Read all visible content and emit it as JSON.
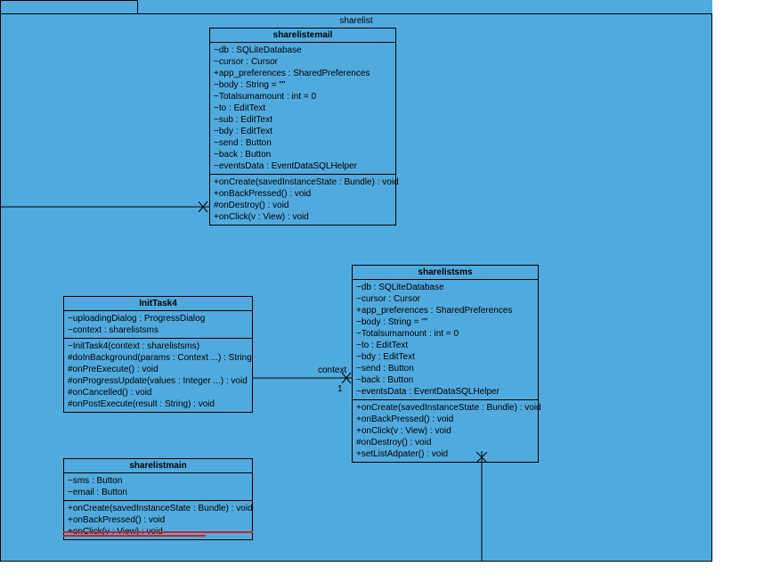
{
  "package": {
    "title": "sharelist"
  },
  "classes": {
    "sharelistemail": {
      "name": "sharelistemail",
      "attrs": [
        "~db : SQLiteDatabase",
        "~cursor : Cursor",
        "+app_preferences : SharedPreferences",
        "~body : String = \"\"",
        "~Totalsumamount : int = 0",
        "~to : EditText",
        "~sub : EditText",
        "~bdy : EditText",
        "~send : Button",
        "~back : Button",
        "~eventsData : EventDataSQLHelper"
      ],
      "ops": [
        "+onCreate(savedInstanceState : Bundle) : void",
        "+onBackPressed() : void",
        "#onDestroy() : void",
        "+onClick(v : View) : void"
      ]
    },
    "sharelistsms": {
      "name": "sharelistsms",
      "attrs": [
        "~db : SQLiteDatabase",
        "~cursor : Cursor",
        "+app_preferences : SharedPreferences",
        "~body : String = \"\"",
        "~Totalsumamount : int = 0",
        "~to : EditText",
        "~bdy : EditText",
        "~send : Button",
        "~back : Button",
        "~eventsData : EventDataSQLHelper"
      ],
      "ops": [
        "+onCreate(savedInstanceState : Bundle) : void",
        "+onBackPressed() : void",
        "+onClick(v : View) : void",
        "#onDestroy() : void",
        "+setListAdpater() : void"
      ]
    },
    "inittask4": {
      "name": "InitTask4",
      "attrs": [
        "~uploadingDialog : ProgressDialog",
        "~context : sharelistsms"
      ],
      "ops": [
        "~InitTask4(context : sharelistsms)",
        "#doInBackground(params : Context ...) : String",
        "#onPreExecute() : void",
        "#onProgressUpdate(values : Integer ...) : void",
        "#onCancelled() : void",
        "#onPostExecute(result : String) : void"
      ]
    },
    "sharelistmain": {
      "name": "sharelistmain",
      "attrs": [
        "~sms : Button",
        "~email : Button"
      ],
      "ops": [
        "+onCreate(savedInstanceState : Bundle) : void",
        "+onBackPressed() : void",
        "+onClick(v : View) : void"
      ]
    }
  },
  "labels": {
    "context": "context",
    "one": "1"
  }
}
